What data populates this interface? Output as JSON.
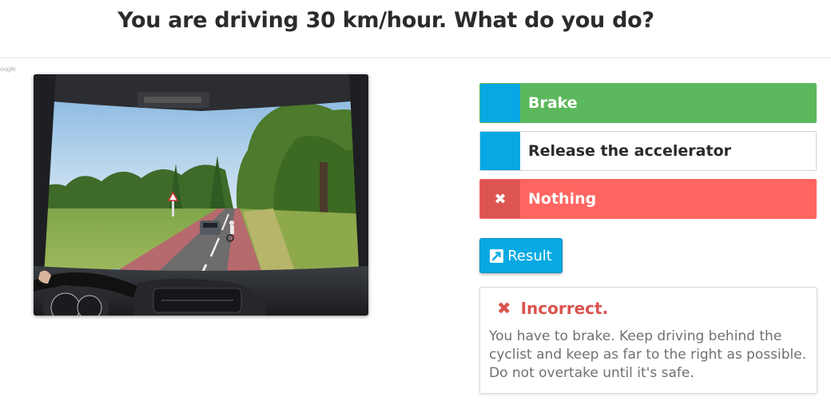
{
  "question": {
    "title": "You are driving 30 km/hour. What do you do?"
  },
  "watermark": "oogle",
  "answers": [
    {
      "label": "Brake",
      "state": "correct"
    },
    {
      "label": "Release the accelerator",
      "state": "neutral"
    },
    {
      "label": "Nothing",
      "state": "wrong",
      "marker_glyph": "✖"
    }
  ],
  "result_button": {
    "label": "Result",
    "icon": "external-link-icon"
  },
  "feedback": {
    "icon": "✖",
    "heading": "Incorrect.",
    "lines": [
      "You have to brake. Keep driving behind the",
      "cyclist and keep as far to the right as possible.",
      "Do not overtake until it's safe."
    ]
  },
  "colors": {
    "accent_blue": "#06a9e3",
    "correct_green": "#5cb85c",
    "wrong_red": "#ff6561",
    "error_text": "#d9534f"
  }
}
